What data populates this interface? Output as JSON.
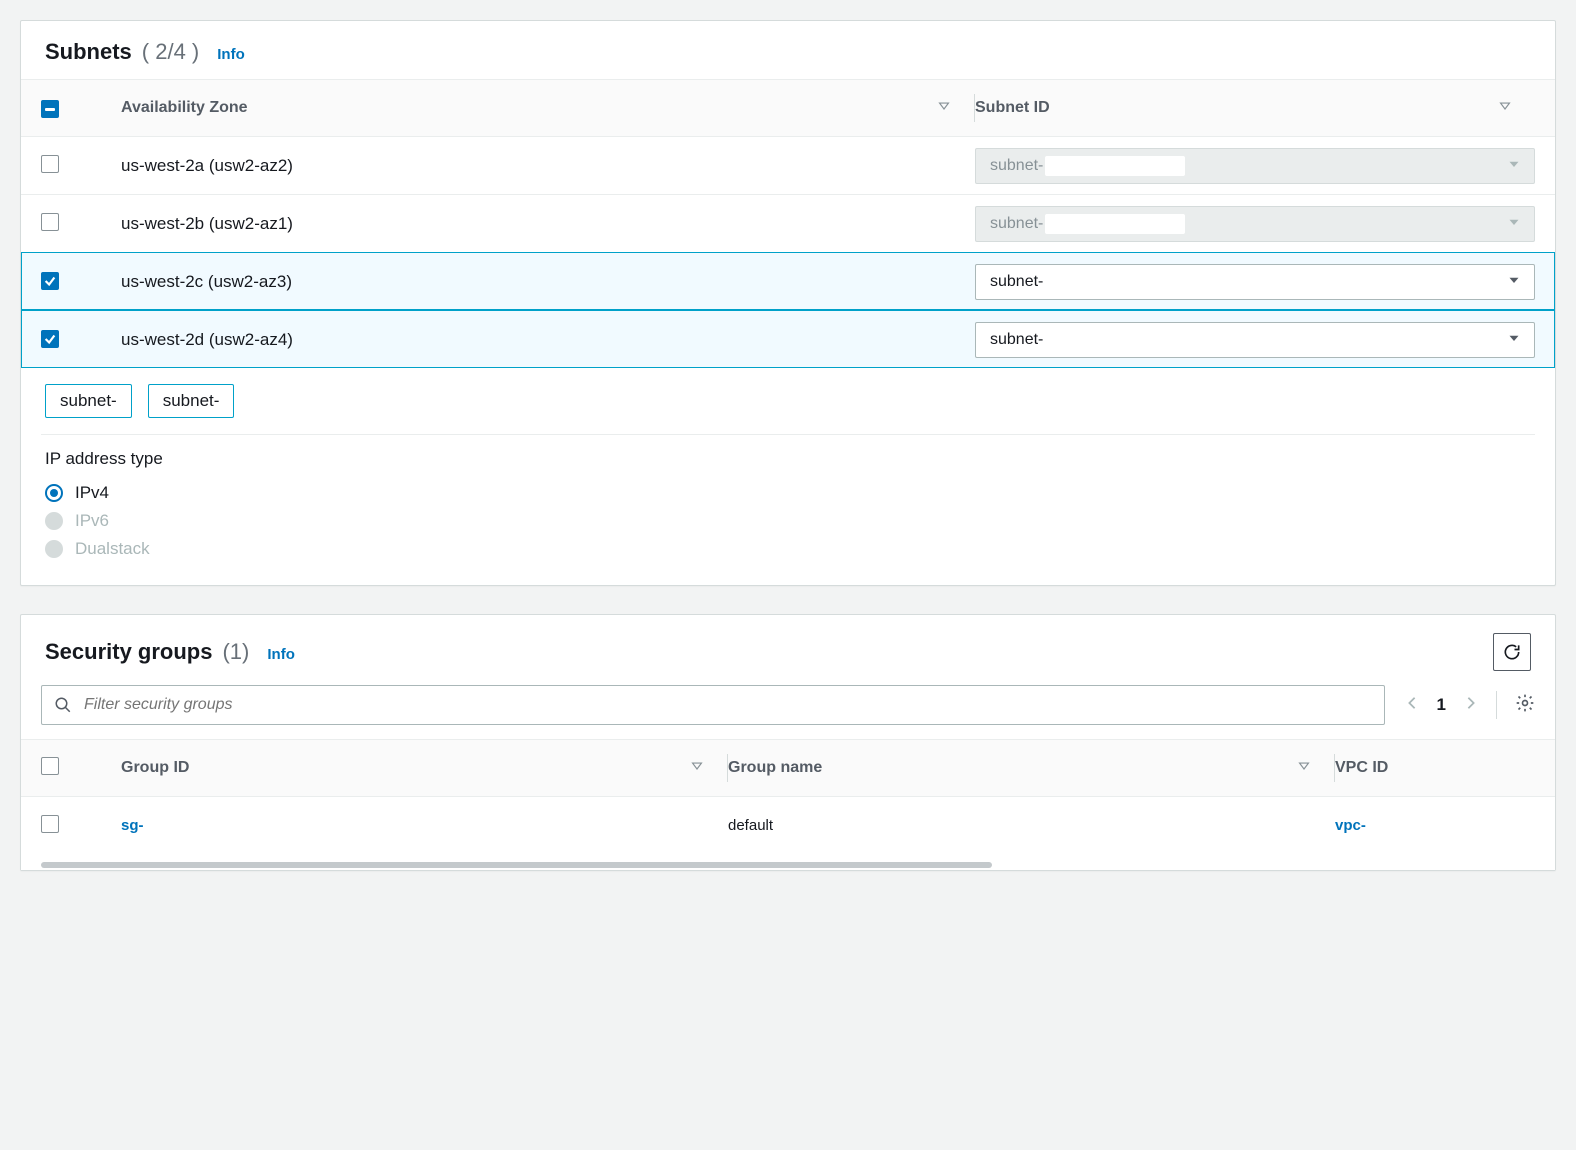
{
  "subnets": {
    "title": "Subnets",
    "count": "( 2/4 )",
    "info": "Info",
    "columns": {
      "az": "Availability Zone",
      "subnet_id": "Subnet ID"
    },
    "rows": [
      {
        "checked": false,
        "az": "us-west-2a (usw2-az2)",
        "subnet": "subnet-",
        "disabled": true
      },
      {
        "checked": false,
        "az": "us-west-2b (usw2-az1)",
        "subnet": "subnet-",
        "disabled": true
      },
      {
        "checked": true,
        "az": "us-west-2c (usw2-az3)",
        "subnet": "subnet-",
        "disabled": false
      },
      {
        "checked": true,
        "az": "us-west-2d (usw2-az4)",
        "subnet": "subnet-",
        "disabled": false
      }
    ],
    "chips": [
      "subnet-",
      "subnet-"
    ],
    "ip": {
      "title": "IP address type",
      "options": [
        {
          "label": "IPv4",
          "selected": true,
          "disabled": false
        },
        {
          "label": "IPv6",
          "selected": false,
          "disabled": true
        },
        {
          "label": "Dualstack",
          "selected": false,
          "disabled": true
        }
      ]
    }
  },
  "security_groups": {
    "title": "Security groups",
    "count": "(1)",
    "info": "Info",
    "filter_placeholder": "Filter security groups",
    "page": "1",
    "columns": {
      "group_id": "Group ID",
      "group_name": "Group name",
      "vpc_id": "VPC ID"
    },
    "rows": [
      {
        "group_id": "sg-",
        "group_name": "default",
        "vpc_id": "vpc-"
      }
    ]
  }
}
